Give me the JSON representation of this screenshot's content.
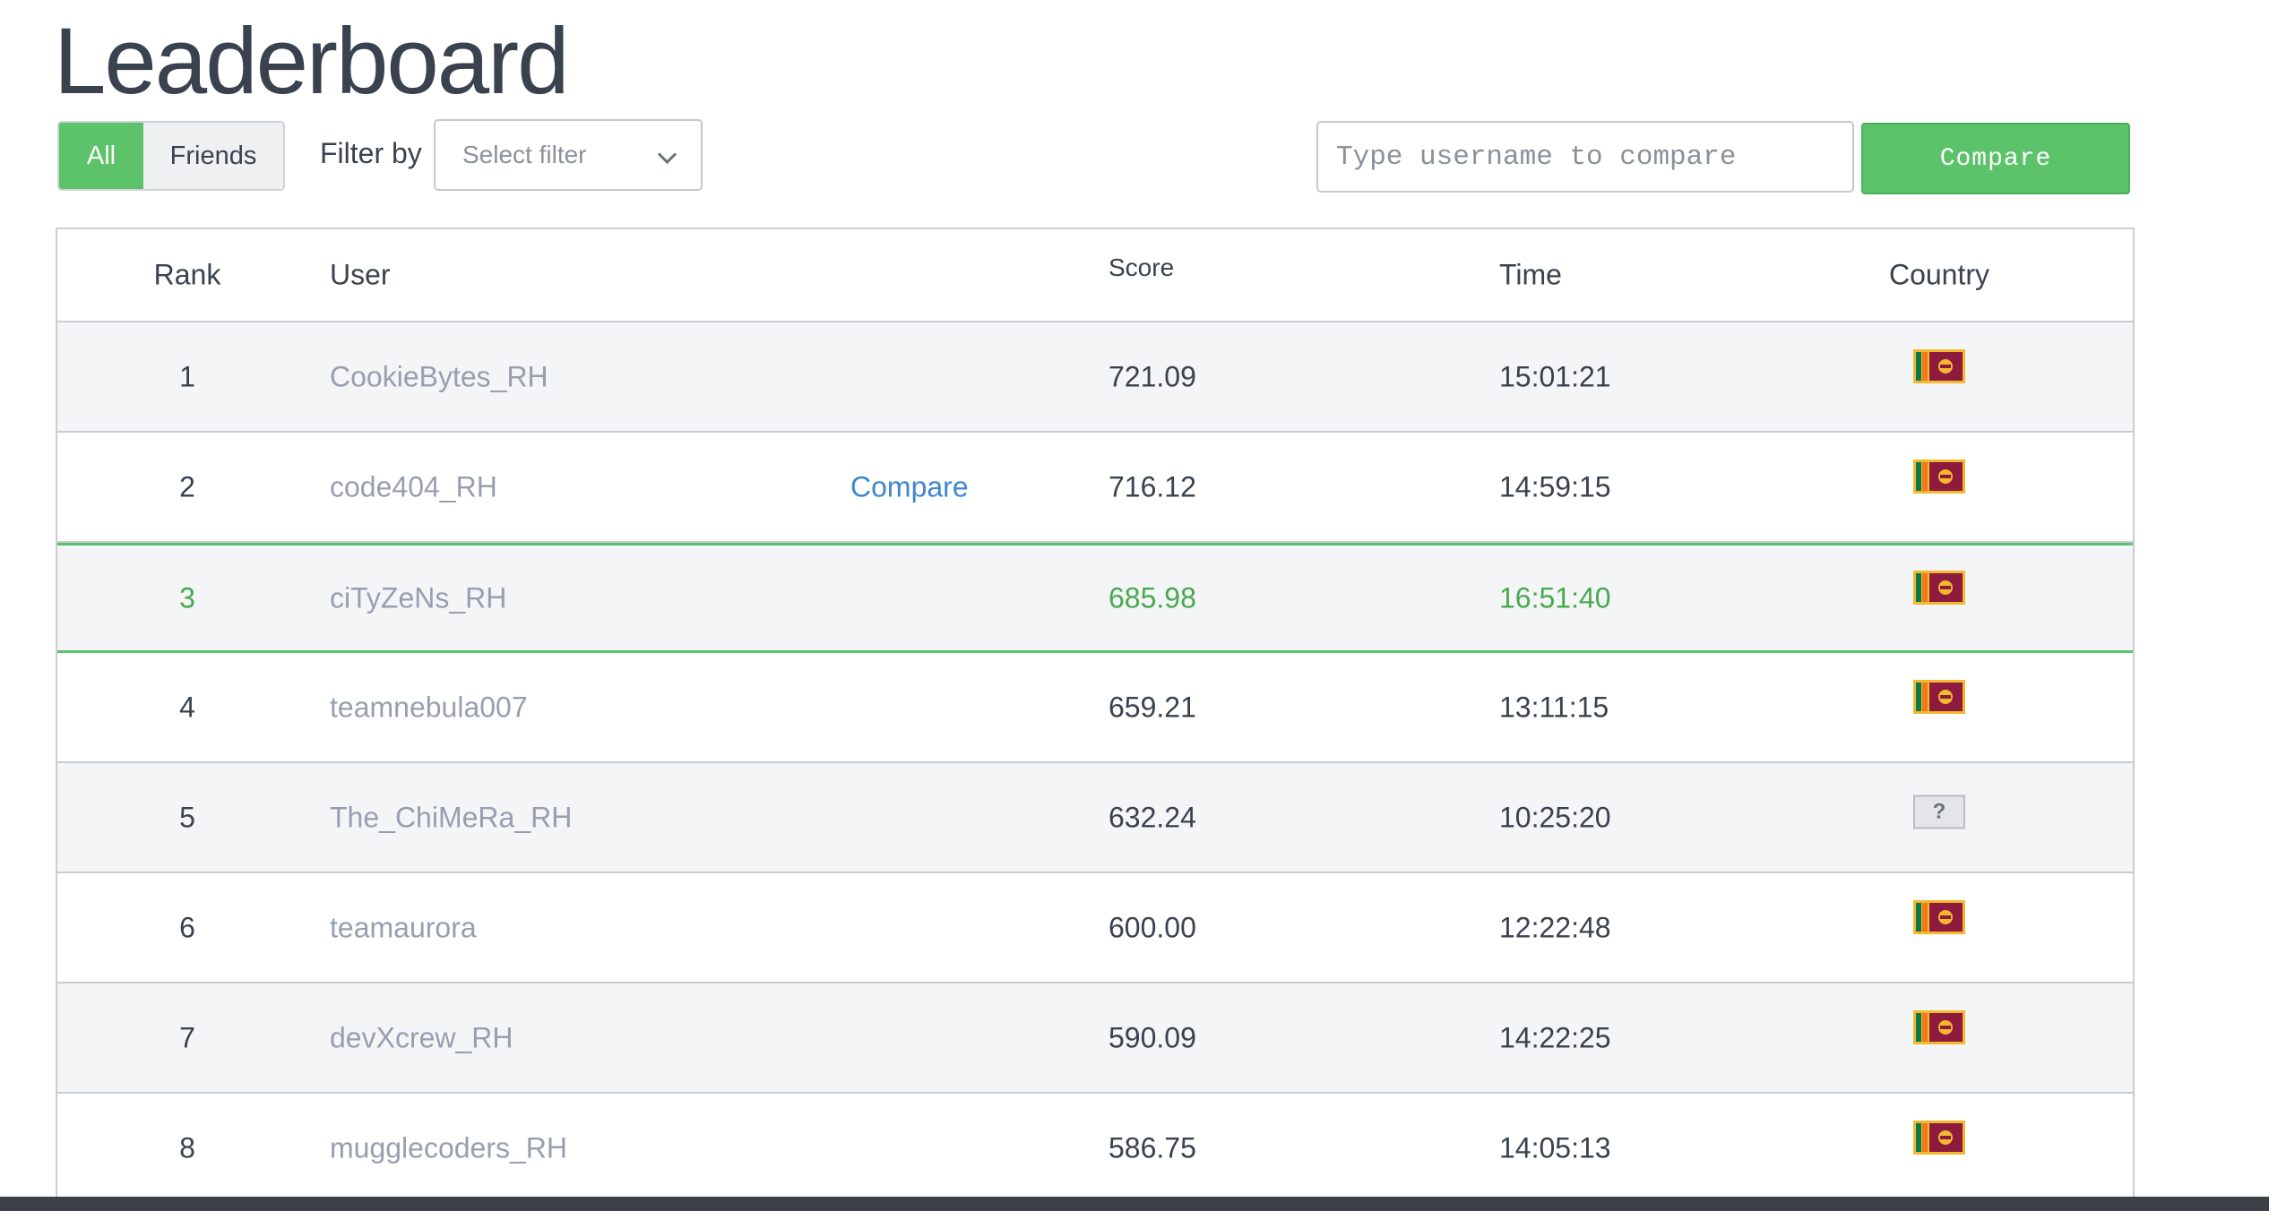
{
  "title": "Leaderboard",
  "toggle": {
    "all_label": "All",
    "friends_label": "Friends",
    "active": "All"
  },
  "filter": {
    "label": "Filter by",
    "placeholder": "Select filter"
  },
  "compare": {
    "input_placeholder": "Type username to compare",
    "button_label": "Compare"
  },
  "table": {
    "headers": {
      "rank": "Rank",
      "user": "User",
      "score": "Score",
      "time": "Time",
      "country": "Country"
    },
    "rows": [
      {
        "rank": "1",
        "user": "CookieBytes_RH",
        "score": "721.09",
        "time": "15:01:21",
        "country_icon": "sri-lanka-flag-icon"
      },
      {
        "rank": "2",
        "user": "code404_RH",
        "compare_label": "Compare",
        "score": "716.12",
        "time": "14:59:15",
        "country_icon": "sri-lanka-flag-icon"
      },
      {
        "rank": "3",
        "user": "ciTyZeNs_RH",
        "score": "685.98",
        "time": "16:51:40",
        "country_icon": "sri-lanka-flag-icon",
        "highlighted": true
      },
      {
        "rank": "4",
        "user": "teamnebula007",
        "score": "659.21",
        "time": "13:11:15",
        "country_icon": "sri-lanka-flag-icon"
      },
      {
        "rank": "5",
        "user": "The_ChiMeRa_RH",
        "score": "632.24",
        "time": "10:25:20",
        "country_icon": "unknown-flag-icon"
      },
      {
        "rank": "6",
        "user": "teamaurora",
        "score": "600.00",
        "time": "12:22:48",
        "country_icon": "sri-lanka-flag-icon"
      },
      {
        "rank": "7",
        "user": "devXcrew_RH",
        "score": "590.09",
        "time": "14:22:25",
        "country_icon": "sri-lanka-flag-icon"
      },
      {
        "rank": "8",
        "user": "mugglecoders_RH",
        "score": "586.75",
        "time": "14:05:13",
        "country_icon": "sri-lanka-flag-icon"
      }
    ]
  },
  "colors": {
    "accent_green": "#5cc36a",
    "link_blue": "#3f86d0",
    "text_dark": "#39424e",
    "text_muted": "#979faf"
  },
  "unknown_flag_glyph": "?"
}
